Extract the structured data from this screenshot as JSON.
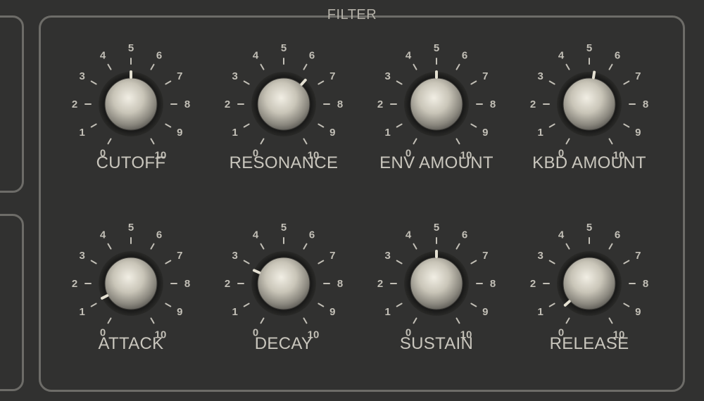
{
  "section": {
    "title": "FILTER"
  },
  "scale": [
    "0",
    "1",
    "2",
    "3",
    "4",
    "5",
    "6",
    "7",
    "8",
    "9",
    "10"
  ],
  "knobs": [
    {
      "id": "cutoff",
      "label": "CUTOFF",
      "value": 5
    },
    {
      "id": "resonance",
      "label": "RESONANCE",
      "value": 6.4
    },
    {
      "id": "env-amount",
      "label": "ENV AMOUNT",
      "value": 5
    },
    {
      "id": "kbd-amount",
      "label": "KBD AMOUNT",
      "value": 5.3
    },
    {
      "id": "attack",
      "label": "ATTACK",
      "value": 1.1
    },
    {
      "id": "decay",
      "label": "DECAY",
      "value": 2.8
    },
    {
      "id": "sustain",
      "label": "SUSTAIN",
      "value": 5
    },
    {
      "id": "release",
      "label": "RELEASE",
      "value": 0.6
    }
  ],
  "colors": {
    "panel_bg": "#313130",
    "border": "#6d6c68",
    "text": "#c9c6bd",
    "indicator": "#e4e0d2"
  }
}
